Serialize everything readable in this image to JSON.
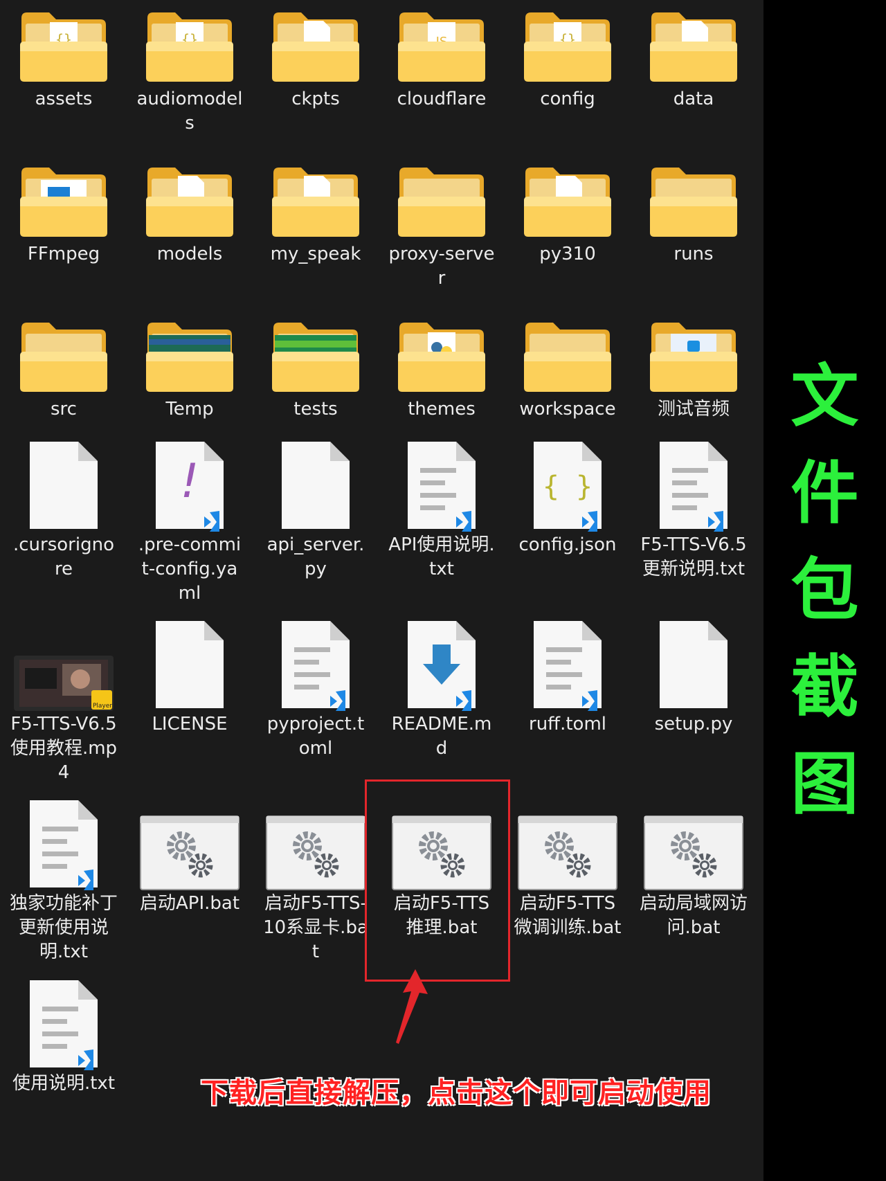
{
  "colors": {
    "background": "#1b1b1b",
    "highlight": "#e3262b",
    "side_caption": "#2cf03c",
    "bottom_note": "#ff2222"
  },
  "items": [
    {
      "name": "assets",
      "type": "folder",
      "icon": "folder-json-icon"
    },
    {
      "name": "audiomodels",
      "type": "folder",
      "icon": "folder-json-icon"
    },
    {
      "name": "ckpts",
      "type": "folder",
      "icon": "folder-file-icon"
    },
    {
      "name": "cloudflare",
      "type": "folder",
      "icon": "folder-js-icon"
    },
    {
      "name": "config",
      "type": "folder",
      "icon": "folder-json-icon"
    },
    {
      "name": "data",
      "type": "folder",
      "icon": "folder-file-icon"
    },
    {
      "name": "FFmpeg",
      "type": "folder",
      "icon": "folder-window-icon"
    },
    {
      "name": "models",
      "type": "folder",
      "icon": "folder-file-icon"
    },
    {
      "name": "my_speak",
      "type": "folder",
      "icon": "folder-file-icon"
    },
    {
      "name": "proxy-server",
      "type": "folder",
      "icon": "folder-icon"
    },
    {
      "name": "py310",
      "type": "folder",
      "icon": "folder-file-icon"
    },
    {
      "name": "runs",
      "type": "folder",
      "icon": "folder-icon"
    },
    {
      "name": "src",
      "type": "folder",
      "icon": "folder-icon"
    },
    {
      "name": "Temp",
      "type": "folder",
      "icon": "folder-spectrogram-icon"
    },
    {
      "name": "tests",
      "type": "folder",
      "icon": "folder-waveform-icon"
    },
    {
      "name": "themes",
      "type": "folder",
      "icon": "folder-python-icon"
    },
    {
      "name": "workspace",
      "type": "folder",
      "icon": "folder-icon"
    },
    {
      "name": "测试音频",
      "type": "folder",
      "icon": "folder-image-icon"
    },
    {
      "name": ".cursorignore",
      "type": "file",
      "icon": "blank-file-icon"
    },
    {
      "name": ".pre-commit-config.yaml",
      "type": "file",
      "icon": "yaml-file-icon"
    },
    {
      "name": "api_server.py",
      "type": "file",
      "icon": "blank-file-icon"
    },
    {
      "name": "API使用说明.txt",
      "type": "file",
      "icon": "text-file-icon"
    },
    {
      "name": "config.json",
      "type": "file",
      "icon": "json-file-icon"
    },
    {
      "name": "F5-TTS-V6.5更新说明.txt",
      "type": "file",
      "icon": "text-file-icon"
    },
    {
      "name": "F5-TTS-V6.5使用教程.mp4",
      "type": "file",
      "icon": "video-thumbnail-icon"
    },
    {
      "name": "LICENSE",
      "type": "file",
      "icon": "blank-file-icon"
    },
    {
      "name": "pyproject.toml",
      "type": "file",
      "icon": "text-file-icon"
    },
    {
      "name": "README.md",
      "type": "file",
      "icon": "markdown-file-icon"
    },
    {
      "name": "ruff.toml",
      "type": "file",
      "icon": "text-file-icon"
    },
    {
      "name": "setup.py",
      "type": "file",
      "icon": "blank-file-icon"
    },
    {
      "name": "独家功能补丁更新使用说明.txt",
      "type": "file",
      "icon": "text-file-icon"
    },
    {
      "name": "启动API.bat",
      "type": "file",
      "icon": "batch-gear-icon"
    },
    {
      "name": "启动F5-TTS-10系显卡.bat",
      "type": "file",
      "icon": "batch-gear-icon"
    },
    {
      "name": "启动F5-TTS推理.bat",
      "type": "file",
      "icon": "batch-gear-icon"
    },
    {
      "name": "启动F5-TTS微调训练.bat",
      "type": "file",
      "icon": "batch-gear-icon"
    },
    {
      "name": "启动局域网访问.bat",
      "type": "file",
      "icon": "batch-gear-icon"
    },
    {
      "name": "使用说明.txt",
      "type": "file",
      "icon": "text-file-icon"
    }
  ],
  "video_badge": "Player",
  "side_caption": [
    "文",
    "件",
    "包",
    "截",
    "图"
  ],
  "bottom_note": "下载后直接解压，点击这个即可启动使用"
}
